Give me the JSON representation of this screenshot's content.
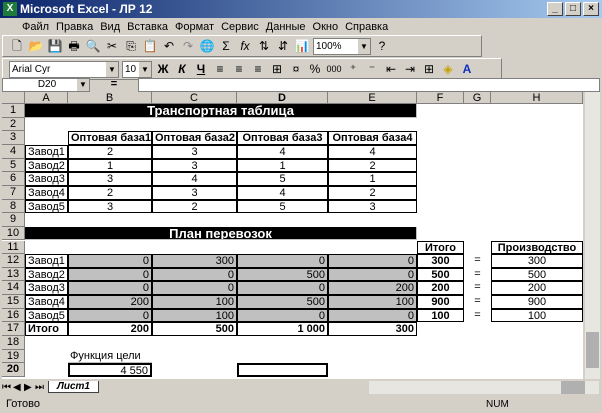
{
  "window": {
    "title": "Microsoft Excel - ЛР 12",
    "min": "_",
    "max": "□",
    "close": "×"
  },
  "menu": [
    "Файл",
    "Правка",
    "Вид",
    "Вставка",
    "Формат",
    "Сервис",
    "Данные",
    "Окно",
    "Справка"
  ],
  "toolbar": {
    "zoom": "100%",
    "font": "Arial Cyr",
    "size": "10",
    "bold": "Ж",
    "italic": "К",
    "underline": "Ч",
    "percent": "%",
    "thousands": "000",
    "sigma": "Σ",
    "fx": "fx"
  },
  "formula": {
    "namebox": "D20",
    "eq": "=",
    "value": ""
  },
  "columns": [
    "A",
    "B",
    "C",
    "D",
    "E",
    "F",
    "G",
    "H"
  ],
  "rows": [
    "1",
    "2",
    "3",
    "4",
    "5",
    "6",
    "7",
    "8",
    "9",
    "10",
    "11",
    "12",
    "13",
    "14",
    "15",
    "16",
    "17",
    "18",
    "19",
    "20"
  ],
  "cells": {
    "r1": "Транспортная таблица",
    "r10": "План перевозок",
    "hdr3": [
      "Оптовая база1",
      "Оптовая база2",
      "Оптовая база3",
      "Оптовая база4"
    ],
    "transport": [
      [
        "Завод1",
        "2",
        "3",
        "4",
        "4"
      ],
      [
        "Завод2",
        "1",
        "3",
        "1",
        "2"
      ],
      [
        "Завод3",
        "3",
        "4",
        "5",
        "1"
      ],
      [
        "Завод4",
        "2",
        "3",
        "4",
        "2"
      ],
      [
        "Завод5",
        "3",
        "2",
        "5",
        "3"
      ]
    ],
    "itogo_hdr": "Итого",
    "prod_hdr": "Производство",
    "plan": [
      [
        "Завод1",
        "0",
        "300",
        "0",
        "0",
        "300",
        "=",
        "300"
      ],
      [
        "Завод2",
        "0",
        "0",
        "500",
        "0",
        "500",
        "=",
        "500"
      ],
      [
        "Завод3",
        "0",
        "0",
        "0",
        "200",
        "200",
        "=",
        "200"
      ],
      [
        "Завод4",
        "200",
        "100",
        "500",
        "100",
        "900",
        "=",
        "900"
      ],
      [
        "Завод5",
        "0",
        "100",
        "0",
        "0",
        "100",
        "=",
        "100"
      ]
    ],
    "total": [
      "Итого",
      "200",
      "500",
      "1 000",
      "300"
    ],
    "goal_label": "Функция цели",
    "goal_value": "4 550"
  },
  "sheet_tab": "Лист1",
  "status": {
    "ready": "Готово",
    "num": "NUM"
  }
}
